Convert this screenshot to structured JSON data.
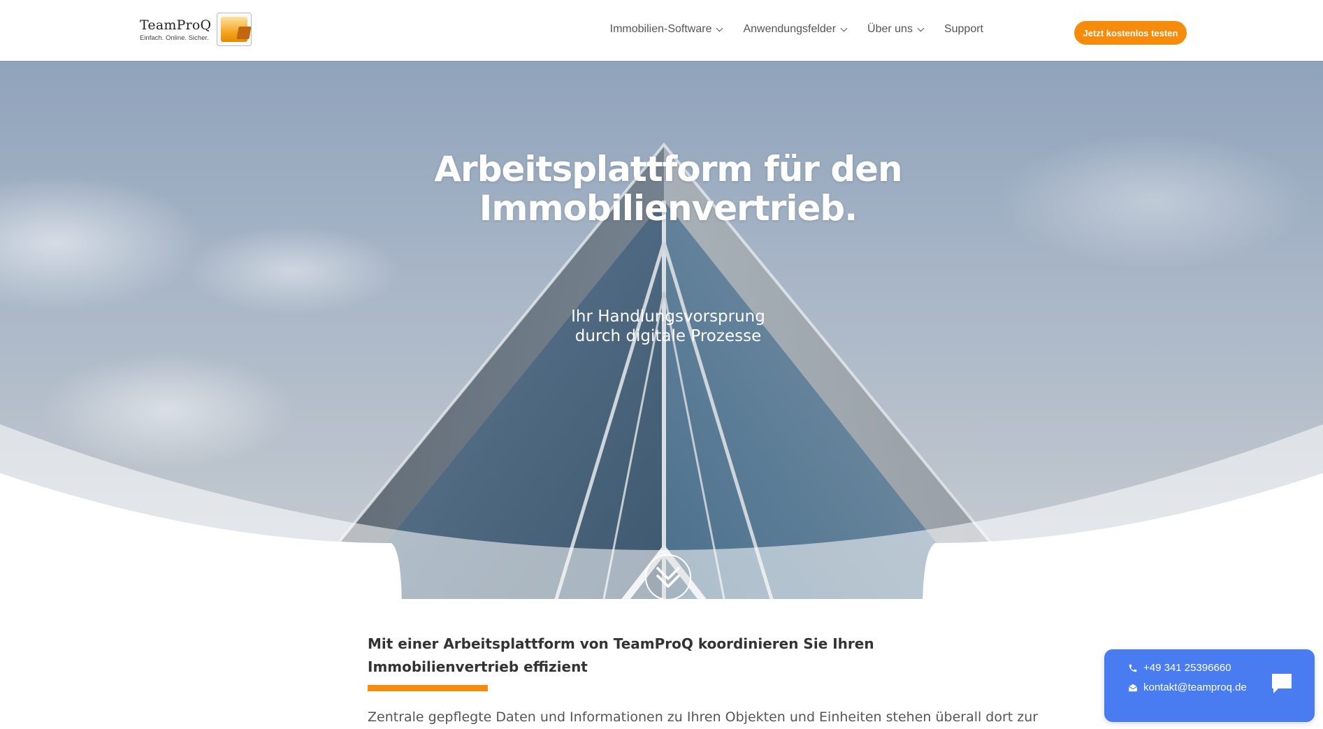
{
  "brand": {
    "name": "TeamProQ",
    "tagline": "Einfach. Online. Sicher."
  },
  "nav": {
    "items": [
      {
        "label": "Immobilien-Software",
        "dropdown": true
      },
      {
        "label": "Anwendungsfelder",
        "dropdown": true
      },
      {
        "label": "Über uns",
        "dropdown": true
      },
      {
        "label": "Support",
        "dropdown": false
      }
    ],
    "cta_label": "Jetzt kostenlos testen"
  },
  "hero": {
    "title_line1": "Arbeitsplattform für den",
    "title_line2": "Immobilienvertrieb.",
    "subtitle_line1": "Ihr Handlungsvorsprung",
    "subtitle_line2": "durch digitale Prozesse",
    "scroll_icon": "double-chevron-down-icon"
  },
  "content": {
    "heading": "Mit einer Arbeitsplattform von TeamProQ koordinieren Sie Ihren Immobilienvertrieb effizient",
    "body": "Zentrale gepflegte Daten und Informationen zu Ihren Objekten und Einheiten stehen überall dort zur"
  },
  "contact": {
    "phone": "+49 341 25396660",
    "email": "kontakt@teamproq.de",
    "icons": [
      "phone-icon",
      "mail-icon",
      "chat-bubble-icon"
    ]
  },
  "colors": {
    "accent": "#f78b0c",
    "widget": "#4a7cf1",
    "text": "#333333"
  }
}
